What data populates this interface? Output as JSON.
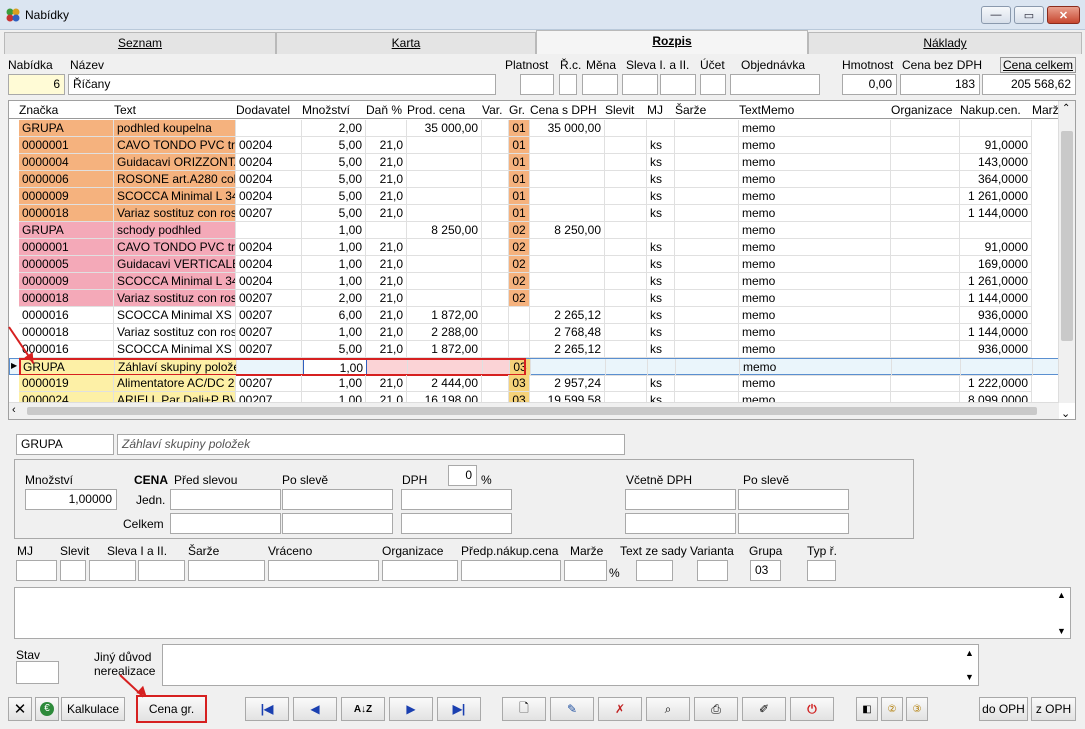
{
  "window": {
    "title": "Nabídky",
    "minimize": "—",
    "maximize": "▭",
    "close": "✕"
  },
  "tabs": [
    "Seznam",
    "Karta",
    "Rozpis",
    "Náklady"
  ],
  "header": {
    "nabidka_label": "Nabídka",
    "nabidka_value": "6",
    "nazev_label": "Název",
    "nazev_value": "Říčany",
    "platnost_label": "Platnost",
    "rc_label": "Ř.c.",
    "mena_label": "Měna",
    "sleva_label": "Sleva I. a II.",
    "ucet_label": "Účet",
    "objednavka_label": "Objednávka",
    "hmotnost_label": "Hmotnost",
    "hmotnost_value": "0,00",
    "cena_bez_label": "Cena bez DPH",
    "cena_bez_value": "183",
    "cena_celkem_label": "Cena celkem",
    "cena_celkem_value": "205 568,62"
  },
  "grid": {
    "columns": [
      "Značka",
      "Text",
      "Dodavatel",
      "Množství",
      "Daň %",
      "Prod. cena",
      "Var.",
      "Gr.",
      "Cena s DPH",
      "Slevit",
      "MJ",
      "Šarže",
      "TextMemo",
      "Organizace",
      "Nakup.cen.",
      "Marže"
    ],
    "rows": [
      {
        "c": [
          "GRUPA",
          "podhled koupelna",
          "",
          "2,00",
          "",
          "35 000,00",
          "",
          "01",
          "35 000,00",
          "",
          "",
          "",
          "memo",
          "",
          ""
        ],
        "bg": "#f5b27e",
        "gr": "#f5b27e"
      },
      {
        "c": [
          "0000001",
          "CAVO TONDO PVC tra",
          "00204",
          "5,00",
          "21,0",
          "",
          "",
          "01",
          "",
          "",
          "ks",
          "",
          "memo",
          "",
          "91,0000"
        ],
        "bg": "#f5b27e",
        "gr": "#f5b27e"
      },
      {
        "c": [
          "0000004",
          "Guidacavi ORIZZONTA",
          "00204",
          "5,00",
          "21,0",
          "",
          "",
          "01",
          "",
          "",
          "ks",
          "",
          "memo",
          "",
          "143,0000"
        ],
        "bg": "#f5b27e",
        "gr": "#f5b27e"
      },
      {
        "c": [
          "0000006",
          "ROSONE art.A280 col",
          "00204",
          "5,00",
          "21,0",
          "",
          "",
          "01",
          "",
          "",
          "ks",
          "",
          "memo",
          "",
          "364,0000"
        ],
        "bg": "#f5b27e",
        "gr": "#f5b27e"
      },
      {
        "c": [
          "0000009",
          "SCOCCA Minimal L 34",
          "00204",
          "5,00",
          "21,0",
          "",
          "",
          "01",
          "",
          "",
          "ks",
          "",
          "memo",
          "",
          "1 261,0000"
        ],
        "bg": "#f5b27e",
        "gr": "#f5b27e"
      },
      {
        "c": [
          "0000018",
          "Variaz sostituz con ros",
          "00207",
          "5,00",
          "21,0",
          "",
          "",
          "01",
          "",
          "",
          "ks",
          "",
          "memo",
          "",
          "1 144,0000"
        ],
        "bg": "#f5b27e",
        "gr": "#f5b27e"
      },
      {
        "c": [
          "GRUPA",
          "schody podhled",
          "",
          "1,00",
          "",
          "8 250,00",
          "",
          "02",
          "8 250,00",
          "",
          "",
          "",
          "memo",
          "",
          ""
        ],
        "bg": "#f4a9b8",
        "gr": "#f5b27e"
      },
      {
        "c": [
          "0000001",
          "CAVO TONDO PVC tra",
          "00204",
          "1,00",
          "21,0",
          "",
          "",
          "02",
          "",
          "",
          "ks",
          "",
          "memo",
          "",
          "91,0000"
        ],
        "bg": "#f4a9b8",
        "gr": "#f5b27e"
      },
      {
        "c": [
          "0000005",
          "Guidacavi VERTICALE",
          "00204",
          "1,00",
          "21,0",
          "",
          "",
          "02",
          "",
          "",
          "ks",
          "",
          "memo",
          "",
          "169,0000"
        ],
        "bg": "#f4a9b8",
        "gr": "#f5b27e"
      },
      {
        "c": [
          "0000009",
          "SCOCCA Minimal L 34",
          "00204",
          "1,00",
          "21,0",
          "",
          "",
          "02",
          "",
          "",
          "ks",
          "",
          "memo",
          "",
          "1 261,0000"
        ],
        "bg": "#f4a9b8",
        "gr": "#f5b27e"
      },
      {
        "c": [
          "0000018",
          "Variaz sostituz con ros",
          "00207",
          "2,00",
          "21,0",
          "",
          "",
          "02",
          "",
          "",
          "ks",
          "",
          "memo",
          "",
          "1 144,0000"
        ],
        "bg": "#f4a9b8",
        "gr": "#f5b27e"
      },
      {
        "c": [
          "0000016",
          "SCOCCA Minimal XS 3",
          "00207",
          "6,00",
          "21,0",
          "1 872,00",
          "",
          "",
          "2 265,12",
          "",
          "ks",
          "",
          "memo",
          "",
          "936,0000"
        ],
        "bg": "#ffffff",
        "gr": "#ffffff"
      },
      {
        "c": [
          "0000018",
          "Variaz sostituz con ros",
          "00207",
          "1,00",
          "21,0",
          "2 288,00",
          "",
          "",
          "2 768,48",
          "",
          "ks",
          "",
          "memo",
          "",
          "1 144,0000"
        ],
        "bg": "#ffffff",
        "gr": "#ffffff"
      },
      {
        "c": [
          "0000016",
          "SCOCCA Minimal XS 3",
          "00207",
          "5,00",
          "21,0",
          "1 872,00",
          "",
          "",
          "2 265,12",
          "",
          "ks",
          "",
          "memo",
          "",
          "936,0000"
        ],
        "bg": "#ffffff",
        "gr": "#ffffff"
      },
      {
        "c": [
          "GRUPA",
          "Záhlaví skupiny polože",
          "",
          "1,00",
          "",
          "",
          "",
          "03",
          "",
          "",
          "",
          "",
          "memo",
          "",
          ""
        ],
        "bg": "#fdf0a6",
        "gr": "#f5d27a",
        "selected": true
      },
      {
        "c": [
          "0000019",
          "Alimentatore AC/DC 2",
          "00207",
          "1,00",
          "21,0",
          "2 444,00",
          "",
          "03",
          "2 957,24",
          "",
          "ks",
          "",
          "memo",
          "",
          "1 222,0000"
        ],
        "bg": "#fdf0a6",
        "gr": "#f5d27a"
      },
      {
        "c": [
          "0000024",
          "ARIELL Par Dali+P BV",
          "00207",
          "1,00",
          "21,0",
          "16 198,00",
          "",
          "03",
          "19 599,58",
          "",
          "ks",
          "",
          "memo",
          "",
          "8 099,0000"
        ],
        "bg": "#fdf0a6",
        "gr": "#f5d27a"
      }
    ]
  },
  "detail": {
    "znacka": "GRUPA",
    "text": "Záhlaví skupiny položek",
    "mnozstvi_label": "Množství",
    "mnozstvi_value": "1,00000",
    "cena_label": "CENA",
    "pred_slevou": "Před slevou",
    "po_sleve": "Po slevě",
    "dph_label": "DPH",
    "dph_value": "0",
    "pct": "%",
    "vcetne_dph": "Včetně DPH",
    "po_sleve2": "Po slevě",
    "jedn": "Jedn.",
    "celkem": "Celkem",
    "mj": "MJ",
    "slevit": "Slevit",
    "sleva": "Sleva I a II.",
    "sarze": "Šarže",
    "vraceno": "Vráceno",
    "organizace": "Organizace",
    "predp": "Předp.nákup.cena",
    "marze": "Marže",
    "marze_pct": "%",
    "text_ze_sady": "Text ze sady",
    "varianta": "Varianta",
    "grupa_label": "Grupa",
    "grupa_value": "03",
    "typ": "Typ ř.",
    "stav": "Stav",
    "jiny1": "Jiný důvod",
    "jiny2": "nerealizace"
  },
  "toolbar": {
    "kalkulace": "Kalkulace",
    "cena_gr": "Cena gr.",
    "do_oph": "do OPH",
    "z_oph": "z OPH"
  }
}
